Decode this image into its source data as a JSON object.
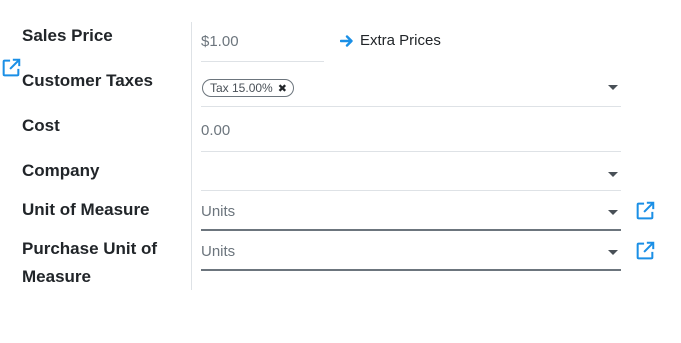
{
  "fields": {
    "sales_price": {
      "label": "Sales Price",
      "value": "$1.00"
    },
    "extra_prices": {
      "label": "Extra Prices"
    },
    "customer_taxes": {
      "label": "Customer Taxes",
      "tag": "Tax 15.00%",
      "tag_remove": "✖"
    },
    "cost": {
      "label": "Cost",
      "value": "0.00"
    },
    "company": {
      "label": "Company",
      "value": ""
    },
    "unit_of_measure": {
      "label": "Unit of Measure",
      "value": "Units"
    },
    "purchase_unit": {
      "label_line1": "Purchase Unit of",
      "label_line2": "Measure",
      "value": "Units"
    }
  },
  "icons": {
    "external_link": "external-link-icon",
    "arrow_right": "arrow-right-icon",
    "dropdown": "caret-down-icon"
  },
  "colors": {
    "accent": "#1a8fe6",
    "label": "#212529",
    "muted": "#6c757d"
  }
}
